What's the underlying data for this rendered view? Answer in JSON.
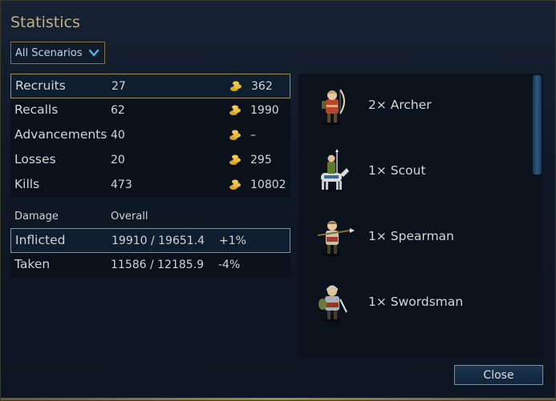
{
  "dialog": {
    "title": "Statistics"
  },
  "filter": {
    "selected": "All Scenarios",
    "icon": "chevron-down-icon"
  },
  "stats": [
    {
      "label": "Recruits",
      "value": "27",
      "cost": "362"
    },
    {
      "label": "Recalls",
      "value": "62",
      "cost": "1990"
    },
    {
      "label": "Advancements",
      "value": "40",
      "cost": "–"
    },
    {
      "label": "Losses",
      "value": "20",
      "cost": "295"
    },
    {
      "label": "Kills",
      "value": "473",
      "cost": "10802"
    }
  ],
  "damage": {
    "header_label": "Damage",
    "header_value": "Overall",
    "rows": [
      {
        "label": "Inflicted",
        "value": "19910 / 19651.4",
        "percent": "+1%"
      },
      {
        "label": "Taken",
        "value": "11586 / 12185.9",
        "percent": "-4%"
      }
    ]
  },
  "units": [
    {
      "name": "2× Archer",
      "icon": "archer-icon"
    },
    {
      "name": "1× Scout",
      "icon": "scout-icon"
    },
    {
      "name": "1× Spearman",
      "icon": "spearman-icon"
    },
    {
      "name": "1× Swordsman",
      "icon": "swordsman-icon"
    }
  ],
  "buttons": {
    "close": "Close"
  },
  "colors": {
    "gold": "#d9a62a",
    "accent_border": "#9e8a56",
    "title": "#bfae8a"
  }
}
